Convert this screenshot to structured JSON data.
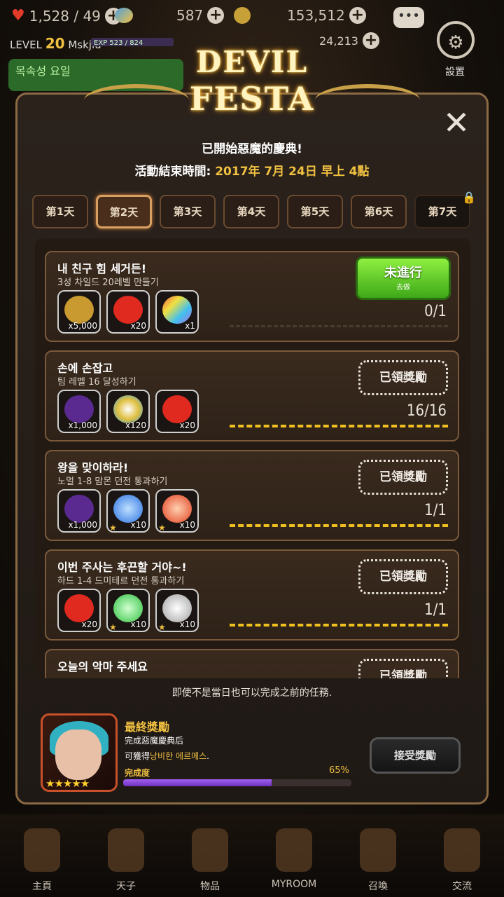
{
  "status": {
    "hearts": "1,528 / 49",
    "gems": "587",
    "gold": "153,512",
    "level_label": "LEVEL",
    "level": "20",
    "player": "Mskjiu",
    "exp": "EXP 523 / 824",
    "coins": "24,213",
    "green_banner": "목속성 요일",
    "settings_label": "設置"
  },
  "logo": {
    "line1": "DEVIL",
    "line2": "FESTA"
  },
  "header": {
    "title": "已開始惡魔的慶典!",
    "end_label": "活動結束時間: ",
    "end_date": "2017年 7月 24日 早上 4點"
  },
  "tabs": [
    "第1天",
    "第2天",
    "第3天",
    "第4天",
    "第5天",
    "第6天",
    "第7天"
  ],
  "missions": [
    {
      "title": "내 친구 힘 세거든!",
      "desc": "3성 차일드 20레벨 만들기",
      "rewards": [
        {
          "icon": "gold-coins-icon",
          "count": "x5,000",
          "color": "#c89a30"
        },
        {
          "icon": "heart-icon",
          "count": "x20",
          "color": "#e02a20"
        },
        {
          "icon": "rainbow-gem-icon",
          "count": "x1",
          "color": "#b070e0"
        }
      ],
      "progress": "0/1",
      "progress_fraction": 0,
      "button": {
        "label": "未進行",
        "sub": "去做"
      }
    },
    {
      "title": "손에 손잡고",
      "desc": "팀 레벨 16 달성하기",
      "rewards": [
        {
          "icon": "dark-heart-gem-icon",
          "count": "x1,000",
          "color": "#5a2a90"
        },
        {
          "icon": "rainbow-orb-icon",
          "count": "x120",
          "color": "#e0c040"
        },
        {
          "icon": "heart-icon",
          "count": "x20",
          "color": "#e02a20"
        }
      ],
      "progress": "16/16",
      "progress_fraction": 1,
      "button": {
        "label": "已領獎勵"
      }
    },
    {
      "title": "왕을 맞이하라!",
      "desc": "노멀 1-8 맘몬 던전 통과하기",
      "rewards": [
        {
          "icon": "dark-heart-gem-icon",
          "count": "x1,000",
          "color": "#5a2a90"
        },
        {
          "icon": "blue-orb-icon",
          "count": "x10",
          "color": "#2a70e0"
        },
        {
          "icon": "red-orb-icon",
          "count": "x10",
          "color": "#e04020"
        }
      ],
      "progress": "1/1",
      "progress_fraction": 1,
      "button": {
        "label": "已領獎勵"
      }
    },
    {
      "title": "이번 주사는 후끈할 거야~!",
      "desc": "하드 1-4 드미테르 던전 통과하기",
      "rewards": [
        {
          "icon": "heart-icon",
          "count": "x20",
          "color": "#e02a20"
        },
        {
          "icon": "green-orb-icon",
          "count": "x10",
          "color": "#30c040"
        },
        {
          "icon": "white-orb-icon",
          "count": "x10",
          "color": "#d0d0d0"
        }
      ],
      "progress": "1/1",
      "progress_fraction": 1,
      "button": {
        "label": "已領獎勵"
      }
    },
    {
      "title": "오늘의 악마 주세요",
      "desc": "",
      "rewards": [],
      "progress": "",
      "progress_fraction": 0,
      "button": {
        "label": "已領獎勵"
      }
    }
  ],
  "note": "即使不是當日也可以完成之前的任務.",
  "final_reward": {
    "title": "最終獎勵",
    "line1": "完成惡魔慶典后",
    "line2_prefix": "可獲得",
    "line2_highlight": "낭비한 에르메스",
    "line2_suffix": ".",
    "completion_label": "完成度",
    "completion_pct": "65%",
    "completion_fraction": 0.65,
    "accept_label": "接受獎勵",
    "stars": "★★★★★"
  },
  "nav": [
    "主頁",
    "天子",
    "物品",
    "MYROOM",
    "召喚",
    "交流"
  ]
}
